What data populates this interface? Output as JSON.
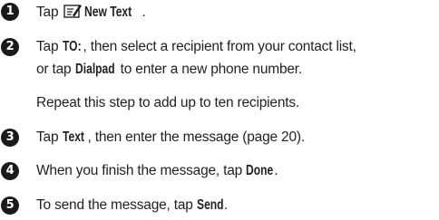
{
  "steps": [
    {
      "number": "1",
      "lines": [
        {
          "pre": "Tap ",
          "icon": "new-text-icon",
          "key": "New Text",
          "post": "."
        }
      ]
    },
    {
      "number": "2",
      "lines": [
        {
          "pre": "Tap ",
          "key": "TO:",
          "post": ", then select a recipient from your contact list,"
        },
        {
          "pre": "or tap ",
          "key": "Dialpad",
          "post": " to enter a new phone number."
        }
      ]
    },
    {
      "note": "Repeat this step to add up to ten recipients."
    },
    {
      "number": "3",
      "lines": [
        {
          "pre": "Tap ",
          "key": "Text",
          "post": ", then enter the message (page 20)."
        }
      ]
    },
    {
      "number": "4",
      "lines": [
        {
          "pre": "When you finish the message, tap ",
          "key": "Done",
          "post": "."
        }
      ]
    },
    {
      "number": "5",
      "lines": [
        {
          "pre": "To send the message, tap ",
          "key": "Send",
          "post": "."
        }
      ]
    }
  ]
}
